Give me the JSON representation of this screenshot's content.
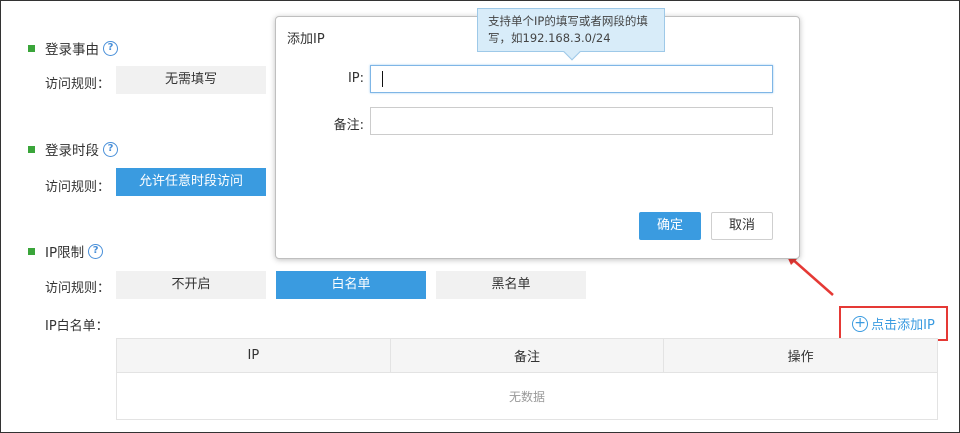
{
  "sections": {
    "login_reason": {
      "title": "登录事由",
      "rule_label": "访问规则：",
      "option": "无需填写"
    },
    "login_time": {
      "title": "登录时段",
      "rule_label": "访问规则：",
      "option": "允许任意时段访问"
    },
    "ip_limit": {
      "title": "IP限制",
      "rule_label": "访问规则：",
      "options": [
        "不开启",
        "白名单",
        "黑名单"
      ],
      "selected": "白名单",
      "whitelist_label": "IP白名单："
    }
  },
  "help_glyph": "?",
  "add_ip_link": "点击添加IP",
  "table": {
    "headers": [
      "IP",
      "备注",
      "操作"
    ],
    "empty_text": "无数据"
  },
  "dialog": {
    "title": "添加IP",
    "ip_label": "IP:",
    "ip_value": "",
    "note_label": "备注:",
    "note_value": "",
    "confirm": "确定",
    "cancel": "取消"
  },
  "tooltip": {
    "line1": "支持单个IP的填写或者网段的填",
    "line2": "写，如192.168.3.0/24"
  },
  "colors": {
    "accent": "#3a9be0",
    "highlight_red": "#e53935",
    "green_marker": "#3aa53a"
  }
}
